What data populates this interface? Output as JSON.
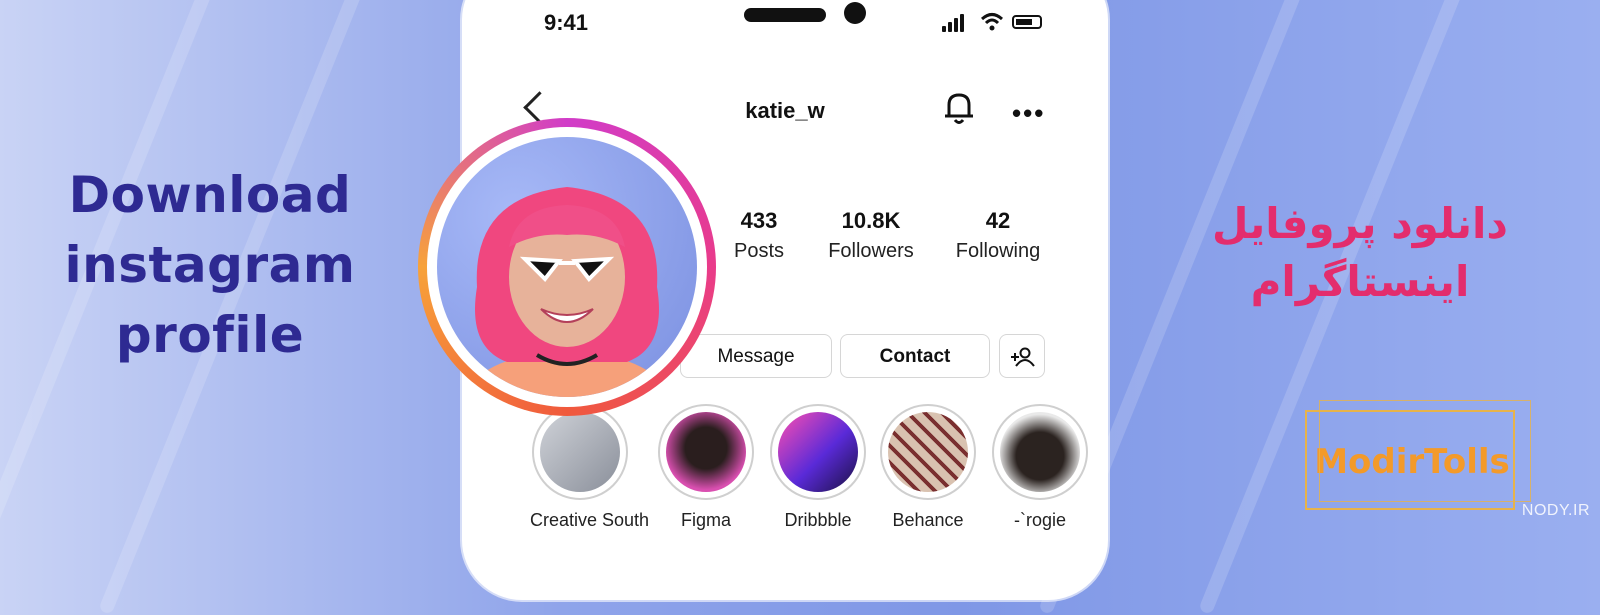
{
  "headline_en": [
    "Download",
    "instagram",
    "profile"
  ],
  "headline_fa": [
    "دانلود پروفایل",
    "اینستاگرام"
  ],
  "brand_logo": "ModirTolls",
  "watermark": "NODY.IR",
  "phone": {
    "status_time": "9:41",
    "username": "katie_w",
    "stats": [
      {
        "value": "433",
        "label": "Posts"
      },
      {
        "value": "10.8K",
        "label": "Followers"
      },
      {
        "value": "42",
        "label": "Following"
      }
    ],
    "buttons": {
      "message": "Message",
      "contact": "Contact"
    },
    "highlights": [
      "Creative South",
      "Figma",
      "Dribbble",
      "Behance",
      "-`rogie"
    ]
  },
  "colors": {
    "headline_en": "#2e2a92",
    "headline_fa": "#e32d6d",
    "brand": "#f39a2a",
    "avatar_ring": "#e93b8a"
  },
  "icons": [
    "back-icon",
    "bell-icon",
    "more-icon",
    "add-person-icon",
    "signal-icon",
    "wifi-icon",
    "battery-icon"
  ]
}
